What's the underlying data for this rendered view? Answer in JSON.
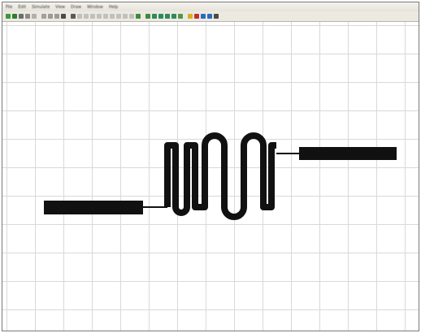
{
  "window": {
    "menus": [
      {
        "label": "File"
      },
      {
        "label": "Edit"
      },
      {
        "label": "Simulate"
      },
      {
        "label": "View"
      },
      {
        "label": "Draw"
      },
      {
        "label": "Window"
      },
      {
        "label": "Help"
      }
    ]
  },
  "toolbar": {
    "tools": [
      {
        "icon": "open-icon",
        "color": "#3a9a3a"
      },
      {
        "icon": "save-icon",
        "color": "#2f7d2f"
      },
      {
        "icon": "print-icon",
        "color": "#6d6d6d"
      },
      {
        "icon": "cut-icon",
        "color": "#8a8a8a"
      },
      {
        "icon": "copy-icon",
        "color": "#b0b0b0"
      },
      {
        "icon": "paste-icon",
        "color": "#a0a0a0"
      },
      {
        "icon": "undo-icon",
        "color": "#9a9a9a"
      },
      {
        "icon": "redo-icon",
        "color": "#9a9a9a"
      },
      {
        "icon": "probe-icon",
        "color": "#4a4a4a"
      },
      {
        "icon": "component-icon",
        "color": "#5a5a5a"
      },
      {
        "icon": "wire-icon",
        "color": "#c0c0c0"
      },
      {
        "icon": "line-icon",
        "color": "#c0c0c0"
      },
      {
        "icon": "arc-icon",
        "color": "#c0c0c0"
      },
      {
        "icon": "rect-icon",
        "color": "#c0c0c0"
      },
      {
        "icon": "poly-icon",
        "color": "#c0c0c0"
      },
      {
        "icon": "text-icon",
        "color": "#c0c0c0"
      },
      {
        "icon": "port-icon",
        "color": "#c0c0c0"
      },
      {
        "icon": "ground-icon",
        "color": "#c0c0c0"
      },
      {
        "icon": "via-icon",
        "color": "#c0c0c0"
      },
      {
        "icon": "layer-icon",
        "color": "#3c8c3c"
      },
      {
        "icon": "route-icon",
        "color": "#3c8c3c"
      },
      {
        "icon": "zoom-in-icon",
        "color": "#2e8a5a"
      },
      {
        "icon": "zoom-out-icon",
        "color": "#2e8a5a"
      },
      {
        "icon": "zoom-fit-icon",
        "color": "#2e8a5a"
      },
      {
        "icon": "pan-icon",
        "color": "#2e8a5a"
      },
      {
        "icon": "redraw-icon",
        "color": "#4a9a4a"
      },
      {
        "icon": "simulate-icon",
        "color": "#d6b020"
      },
      {
        "icon": "tune-icon",
        "color": "#c03030"
      },
      {
        "icon": "optimize-icon",
        "color": "#2a6ac0"
      },
      {
        "icon": "grid-icon",
        "color": "#2a6ac0"
      },
      {
        "icon": "properties-icon",
        "color": "#4a4a4a"
      }
    ]
  },
  "layout_view": {
    "element": "meander-line",
    "trace_color": "#111111",
    "grid_color": "#d9d9d9"
  }
}
